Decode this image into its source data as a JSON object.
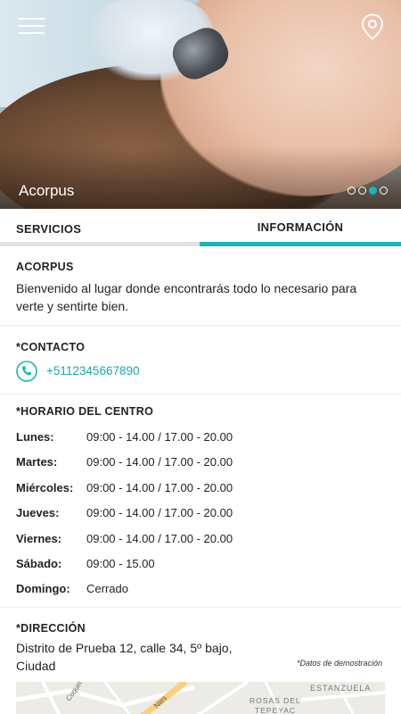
{
  "header": {
    "title": "Acorpus",
    "slide_count": 4,
    "active_slide": 3,
    "accent_color": "#19b5b8"
  },
  "icons": {
    "menu": "menu-icon",
    "location": "map-pin-icon",
    "phone": "phone-icon"
  },
  "tabs": [
    {
      "label": "SERVICIOS",
      "active": false
    },
    {
      "label": "INFORMACIÓN",
      "active": true
    }
  ],
  "about": {
    "title": "ACORPUS",
    "text_line1": "Bienvenido al lugar donde encontrarás todo lo necesario para",
    "text_line2": "verte y sentirte bien."
  },
  "contact": {
    "title": "*CONTACTO",
    "phone": "+5112345667890"
  },
  "schedule": {
    "title": "*HORARIO DEL CENTRO",
    "rows": [
      {
        "day": "Lunes:",
        "hours": "09:00 - 14.00  /  17.00 - 20.00"
      },
      {
        "day": "Martes:",
        "hours": "09:00 - 14.00  /  17.00 - 20.00"
      },
      {
        "day": "Miércoles:",
        "hours": "09:00 - 14.00  /  17.00 - 20.00"
      },
      {
        "day": "Jueves:",
        "hours": "09:00 - 14.00  /  17.00 - 20.00"
      },
      {
        "day": "Viernes:",
        "hours": "09:00 - 14.00  /  17.00 - 20.00"
      },
      {
        "day": "Sábado:",
        "hours": "09:00 - 15.00"
      },
      {
        "day": "Domingo:",
        "hours": "Cerrado"
      }
    ]
  },
  "address": {
    "title": "*DIRECCIÓN",
    "line1": "Distrito de Prueba 12, calle 34, 5º bajo,",
    "line2": "Ciudad",
    "demo_note": "*Datos de demostración"
  },
  "map": {
    "labels": [
      "Coquimbo",
      "ESTANZUELA",
      "ROSAS DEL",
      "TEPEYAC",
      "Ntes"
    ]
  }
}
